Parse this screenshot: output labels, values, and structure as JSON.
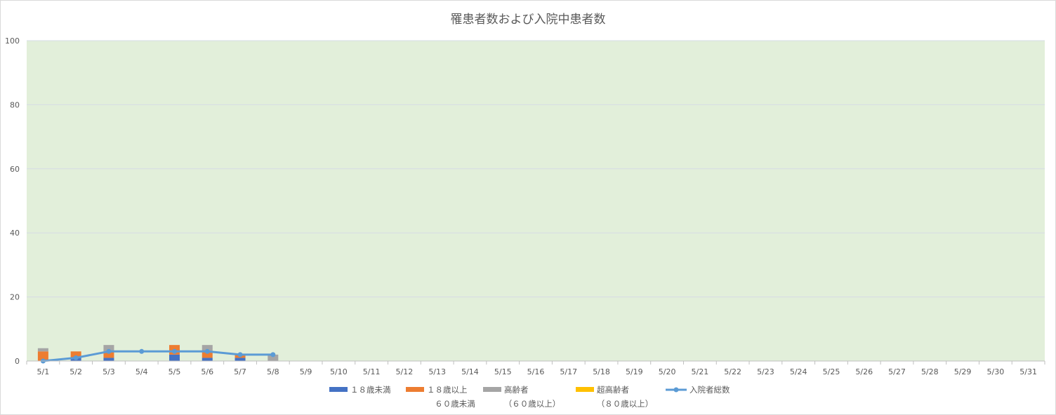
{
  "chart_data": {
    "type": "bar",
    "stacked": true,
    "title": "罹患者数および入院中患者数",
    "xlabel": "",
    "ylabel": "",
    "ylim": [
      0,
      100
    ],
    "yticks": [
      0,
      20,
      40,
      60,
      80,
      100
    ],
    "grid": true,
    "plot_background": "#e2efda",
    "legend_position": "bottom",
    "categories": [
      "5/1",
      "5/2",
      "5/3",
      "5/4",
      "5/5",
      "5/6",
      "5/7",
      "5/8",
      "5/9",
      "5/10",
      "5/11",
      "5/12",
      "5/13",
      "5/14",
      "5/15",
      "5/16",
      "5/17",
      "5/18",
      "5/19",
      "5/20",
      "5/21",
      "5/22",
      "5/23",
      "5/24",
      "5/25",
      "5/26",
      "5/27",
      "5/28",
      "5/29",
      "5/30",
      "5/31"
    ],
    "series": [
      {
        "name": "１８歳未満",
        "kind": "bar",
        "color": "#4472c4",
        "values": [
          0,
          1,
          1,
          0,
          2,
          1,
          1,
          0,
          0,
          0,
          0,
          0,
          0,
          0,
          0,
          0,
          0,
          0,
          0,
          0,
          0,
          0,
          0,
          0,
          0,
          0,
          0,
          0,
          0,
          0,
          0
        ]
      },
      {
        "name": "１８歳以上\n６０歳未満",
        "kind": "bar",
        "color": "#ed7d31",
        "values": [
          3,
          2,
          2,
          0,
          3,
          2,
          1,
          0,
          0,
          0,
          0,
          0,
          0,
          0,
          0,
          0,
          0,
          0,
          0,
          0,
          0,
          0,
          0,
          0,
          0,
          0,
          0,
          0,
          0,
          0,
          0
        ]
      },
      {
        "name": "高齢者\n（６０歳以上）",
        "kind": "bar",
        "color": "#a5a5a5",
        "values": [
          1,
          0,
          2,
          0,
          0,
          2,
          0,
          2,
          0,
          0,
          0,
          0,
          0,
          0,
          0,
          0,
          0,
          0,
          0,
          0,
          0,
          0,
          0,
          0,
          0,
          0,
          0,
          0,
          0,
          0,
          0
        ]
      },
      {
        "name": "超高齢者\n（８０歳以上）",
        "kind": "bar",
        "color": "#ffc000",
        "values": [
          0,
          0,
          0,
          0,
          0,
          0,
          0,
          0,
          0,
          0,
          0,
          0,
          0,
          0,
          0,
          0,
          0,
          0,
          0,
          0,
          0,
          0,
          0,
          0,
          0,
          0,
          0,
          0,
          0,
          0,
          0
        ]
      },
      {
        "name": "入院者総数",
        "kind": "line",
        "color": "#5b9bd5",
        "values": [
          0,
          1,
          3,
          3,
          3,
          3,
          2,
          2
        ]
      }
    ]
  }
}
